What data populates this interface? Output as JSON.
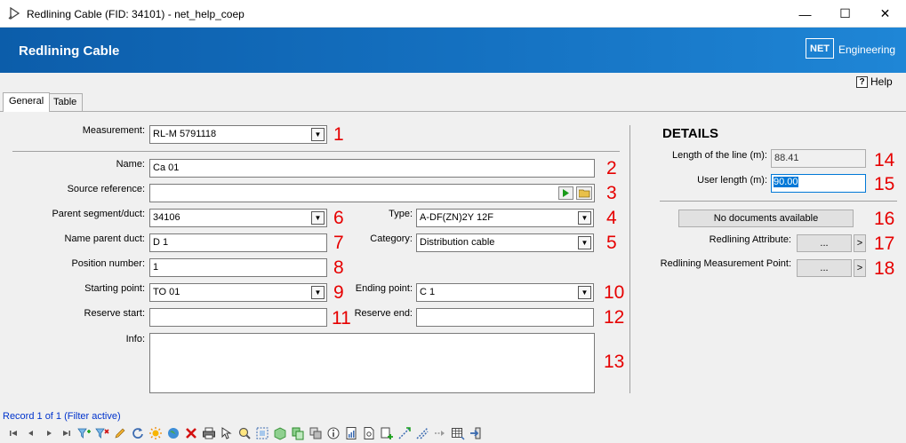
{
  "window": {
    "title": "Redlining Cable (FID: 34101) - net_help_coep",
    "minimize": "—",
    "maximize": "☐",
    "close": "✕"
  },
  "banner": {
    "heading": "Redlining Cable",
    "logo_box": "NET",
    "logo_text": "Engineering"
  },
  "help": {
    "icon": "?",
    "label": "Help"
  },
  "tabs": [
    {
      "label": "General",
      "active": true
    },
    {
      "label": "Table",
      "active": false
    }
  ],
  "form": {
    "measurement": {
      "label": "Measurement:",
      "value": "RL-M 5791118",
      "num": "1"
    },
    "name": {
      "label": "Name:",
      "value": "Ca 01",
      "num": "2"
    },
    "source_reference": {
      "label": "Source reference:",
      "value": "",
      "num": "3"
    },
    "type": {
      "label": "Type:",
      "value": "A-DF(ZN)2Y 12F",
      "num": "4"
    },
    "category": {
      "label": "Category:",
      "value": "Distribution cable",
      "num": "5"
    },
    "parent_segment": {
      "label": "Parent segment/duct:",
      "value": "34106",
      "num": "6"
    },
    "name_parent_duct": {
      "label": "Name parent duct:",
      "value": "D 1",
      "num": "7"
    },
    "position_number": {
      "label": "Position number:",
      "value": "1",
      "num": "8"
    },
    "starting_point": {
      "label": "Starting point:",
      "value": "TO 01",
      "num": "9"
    },
    "ending_point": {
      "label": "Ending point:",
      "value": "C 1",
      "num": "10"
    },
    "reserve_start": {
      "label": "Reserve start:",
      "value": "",
      "num": "11"
    },
    "reserve_end": {
      "label": "Reserve end:",
      "value": "",
      "num": "12"
    },
    "info": {
      "label": "Info:",
      "value": "",
      "num": "13"
    }
  },
  "details": {
    "heading": "DETAILS",
    "length_of_line": {
      "label": "Length of the line (m):",
      "value": "88.41",
      "num": "14"
    },
    "user_length": {
      "label": "User length (m):",
      "value": "90.00",
      "num": "15"
    },
    "documents": {
      "label": "No documents available",
      "num": "16"
    },
    "redlining_attribute": {
      "label": "Redlining Attribute:",
      "button": "...",
      "arrow": ">",
      "num": "17"
    },
    "redlining_measurement_point": {
      "label": "Redlining Measurement Point:",
      "button": "...",
      "arrow": ">",
      "num": "18"
    }
  },
  "status": {
    "record": "Record 1 of 1 (Filter active)"
  },
  "toolbar": {
    "icons": [
      "first-record-icon",
      "prev-record-icon",
      "next-record-icon",
      "last-record-icon",
      "add-filter-icon",
      "remove-filter-icon",
      "edit-icon",
      "refresh-icon",
      "highlight-icon",
      "globe-icon",
      "delete-icon",
      "print-icon",
      "select-icon",
      "zoom-icon",
      "select-area-icon",
      "object-icon",
      "copy-icon",
      "duplicate-icon",
      "info-icon",
      "report-icon",
      "document-icon",
      "add-document-icon",
      "measure-icon",
      "redline-icon",
      "export-icon",
      "table-icon",
      "exit-icon"
    ]
  },
  "colors": {
    "banner": "#1572c2",
    "annotation": "#e60000",
    "record": "#0033cc"
  }
}
